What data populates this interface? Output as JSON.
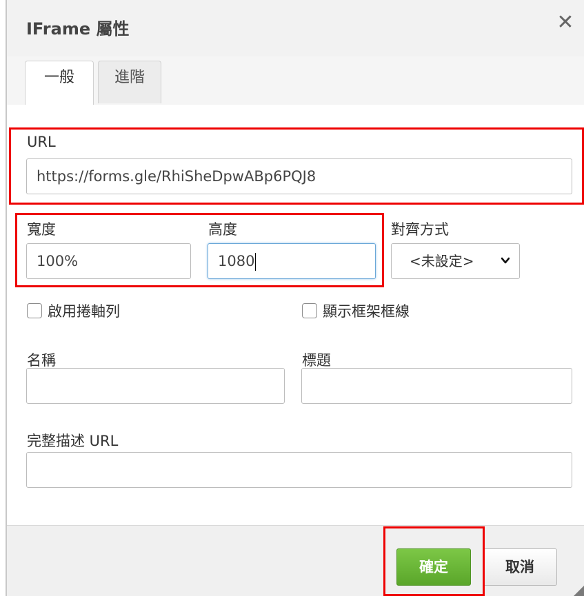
{
  "dialog": {
    "title": "IFrame 屬性",
    "close_glyph": "✕"
  },
  "tabs": [
    {
      "label": "一般",
      "active": true
    },
    {
      "label": "進階",
      "active": false
    }
  ],
  "form": {
    "url": {
      "label": "URL",
      "value": "https://forms.gle/RhiSheDpwABp6PQJ8"
    },
    "width": {
      "label": "寬度",
      "value": "100%"
    },
    "height": {
      "label": "高度",
      "value": "1080"
    },
    "align": {
      "label": "對齊方式",
      "selected": "<未設定>"
    },
    "scrollbar": {
      "label": "啟用捲軸列",
      "checked": false
    },
    "frame_border": {
      "label": "顯示框架框線",
      "checked": false
    },
    "name": {
      "label": "名稱",
      "value": ""
    },
    "title": {
      "label": "標題",
      "value": ""
    },
    "longdesc": {
      "label": "完整描述 URL",
      "value": ""
    }
  },
  "buttons": {
    "ok_label": "確定",
    "cancel_label": "取消"
  },
  "colors": {
    "highlight": "#ee0000",
    "ok_button": "#6cb838",
    "focus": "#6aa7d8"
  }
}
